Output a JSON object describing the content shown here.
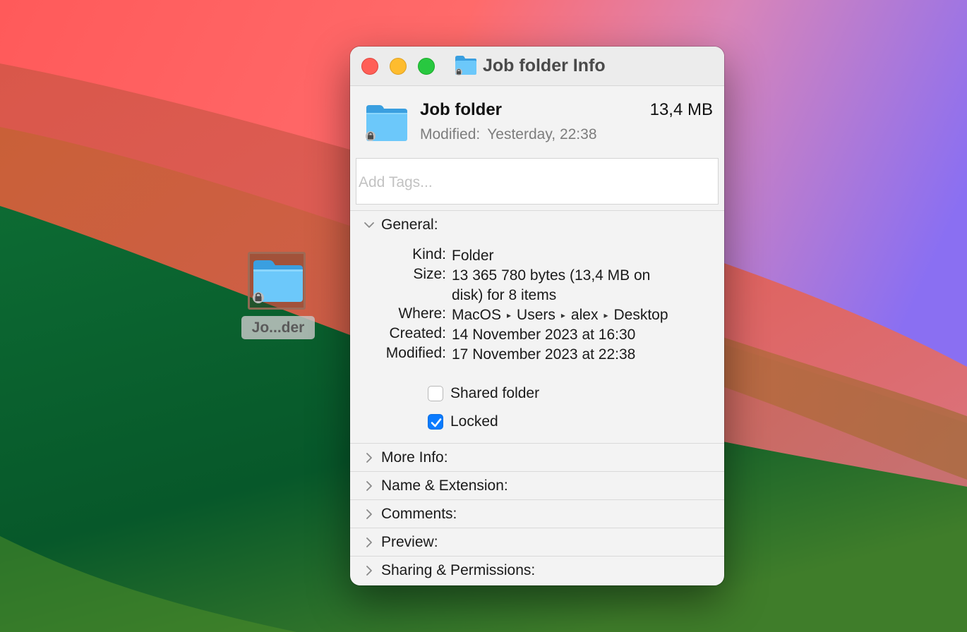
{
  "desktop": {
    "icon_label": "Jo...der"
  },
  "window": {
    "title": "Job folder Info",
    "file_name": "Job folder",
    "file_size": "13,4 MB",
    "modified_label": "Modified:",
    "modified_value": "Yesterday, 22:38",
    "tags_placeholder": "Add Tags..."
  },
  "general": {
    "title": "General:",
    "kind_label": "Kind:",
    "kind_value": "Folder",
    "size_label": "Size:",
    "size_value": "13 365 780 bytes (13,4 MB on disk) for 8 items",
    "where_label": "Where:",
    "where_path": [
      "MacOS",
      "Users",
      "alex",
      "Desktop"
    ],
    "created_label": "Created:",
    "created_value": "14 November 2023 at 16:30",
    "modified_label": "Modified:",
    "modified_value": "17 November 2023 at 22:38",
    "shared_folder_label": "Shared folder",
    "shared_folder_checked": false,
    "locked_label": "Locked",
    "locked_checked": true
  },
  "sections": [
    {
      "label": "More Info:"
    },
    {
      "label": "Name & Extension:"
    },
    {
      "label": "Comments:"
    },
    {
      "label": "Preview:"
    },
    {
      "label": "Sharing & Permissions:"
    }
  ],
  "colors": {
    "checkbox_accent": "#0a7bff",
    "folder_blue": "#6ac4f7",
    "traffic_close": "#ff5f57",
    "traffic_min": "#febc2e",
    "traffic_max": "#28c840"
  }
}
